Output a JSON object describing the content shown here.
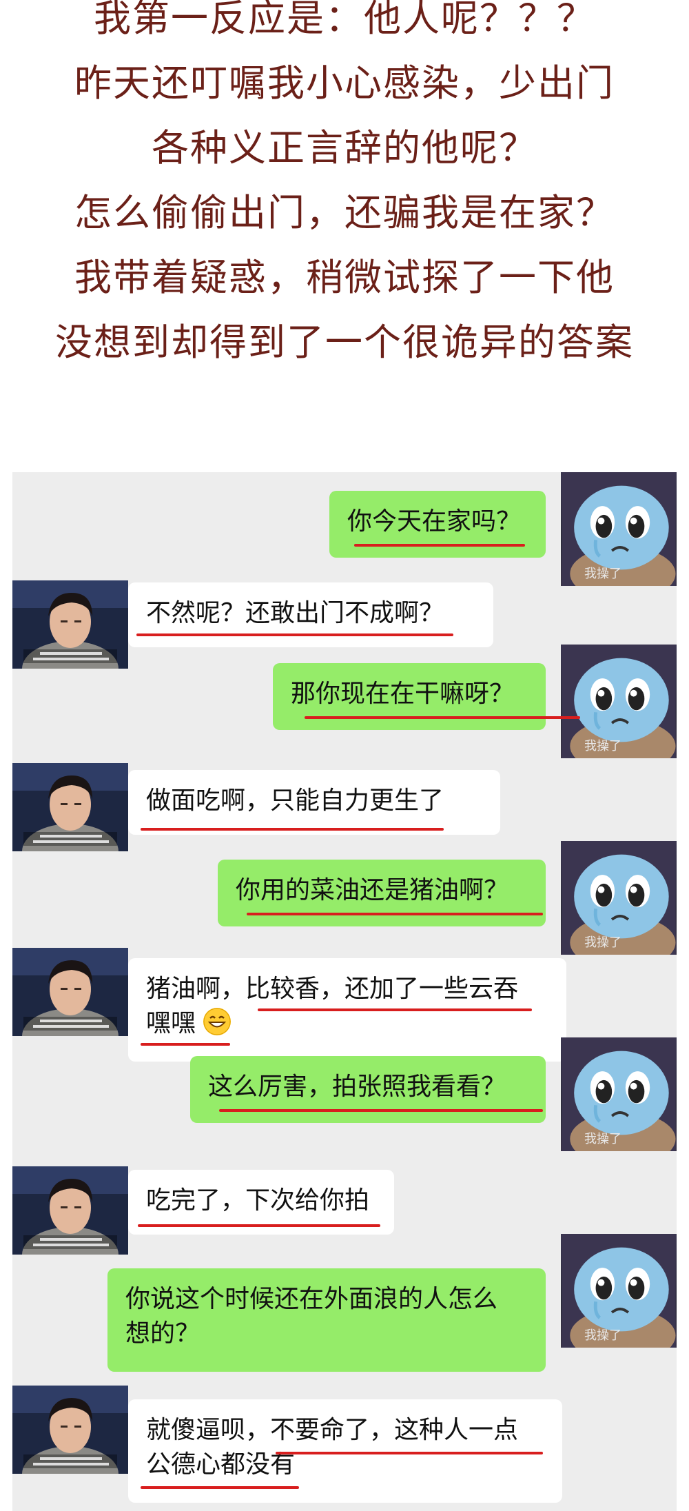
{
  "intro_lines": [
    "我第一反应是：他人呢？？？",
    "昨天还叮嘱我小心感染，少出门",
    "各种义正言辞的他呢？",
    "怎么偷偷出门，还骗我是在家？",
    "我带着疑惑，稍微试探了一下他",
    "没想到却得到了一个很诡异的答案"
  ],
  "me_avatar_caption": "我操了",
  "messages": [
    {
      "side": "me",
      "text": "你今天在家吗？"
    },
    {
      "side": "friend",
      "text": "不然呢？还敢出门不成啊？"
    },
    {
      "side": "me",
      "text": "那你现在在干嘛呀？"
    },
    {
      "side": "friend",
      "text": "做面吃啊，只能自力更生了"
    },
    {
      "side": "me",
      "text": "你用的菜油还是猪油啊？"
    },
    {
      "side": "friend",
      "text": "猪油啊，比较香，还加了一些云吞",
      "text2": "嘿嘿"
    },
    {
      "side": "me",
      "text": "这么厉害，拍张照我看看？"
    },
    {
      "side": "friend",
      "text": "吃完了，下次给你拍"
    },
    {
      "side": "me",
      "text": "你说这个时候还在外面浪的人怎么",
      "text2": "想的？"
    },
    {
      "side": "friend",
      "text": "就傻逼呗，不要命了，这种人一点",
      "text2": "公德心都没有"
    }
  ],
  "colors": {
    "intro_text": "#6b2018",
    "chat_bg": "#ededed",
    "my_bubble": "#95ec69",
    "friend_bubble": "#ffffff",
    "underline": "#d81e1e"
  },
  "icons": {
    "my_avatar": "squirtle-crying-icon",
    "friend_avatar": "man-portrait-icon",
    "emoji": "grinning-face-icon"
  }
}
